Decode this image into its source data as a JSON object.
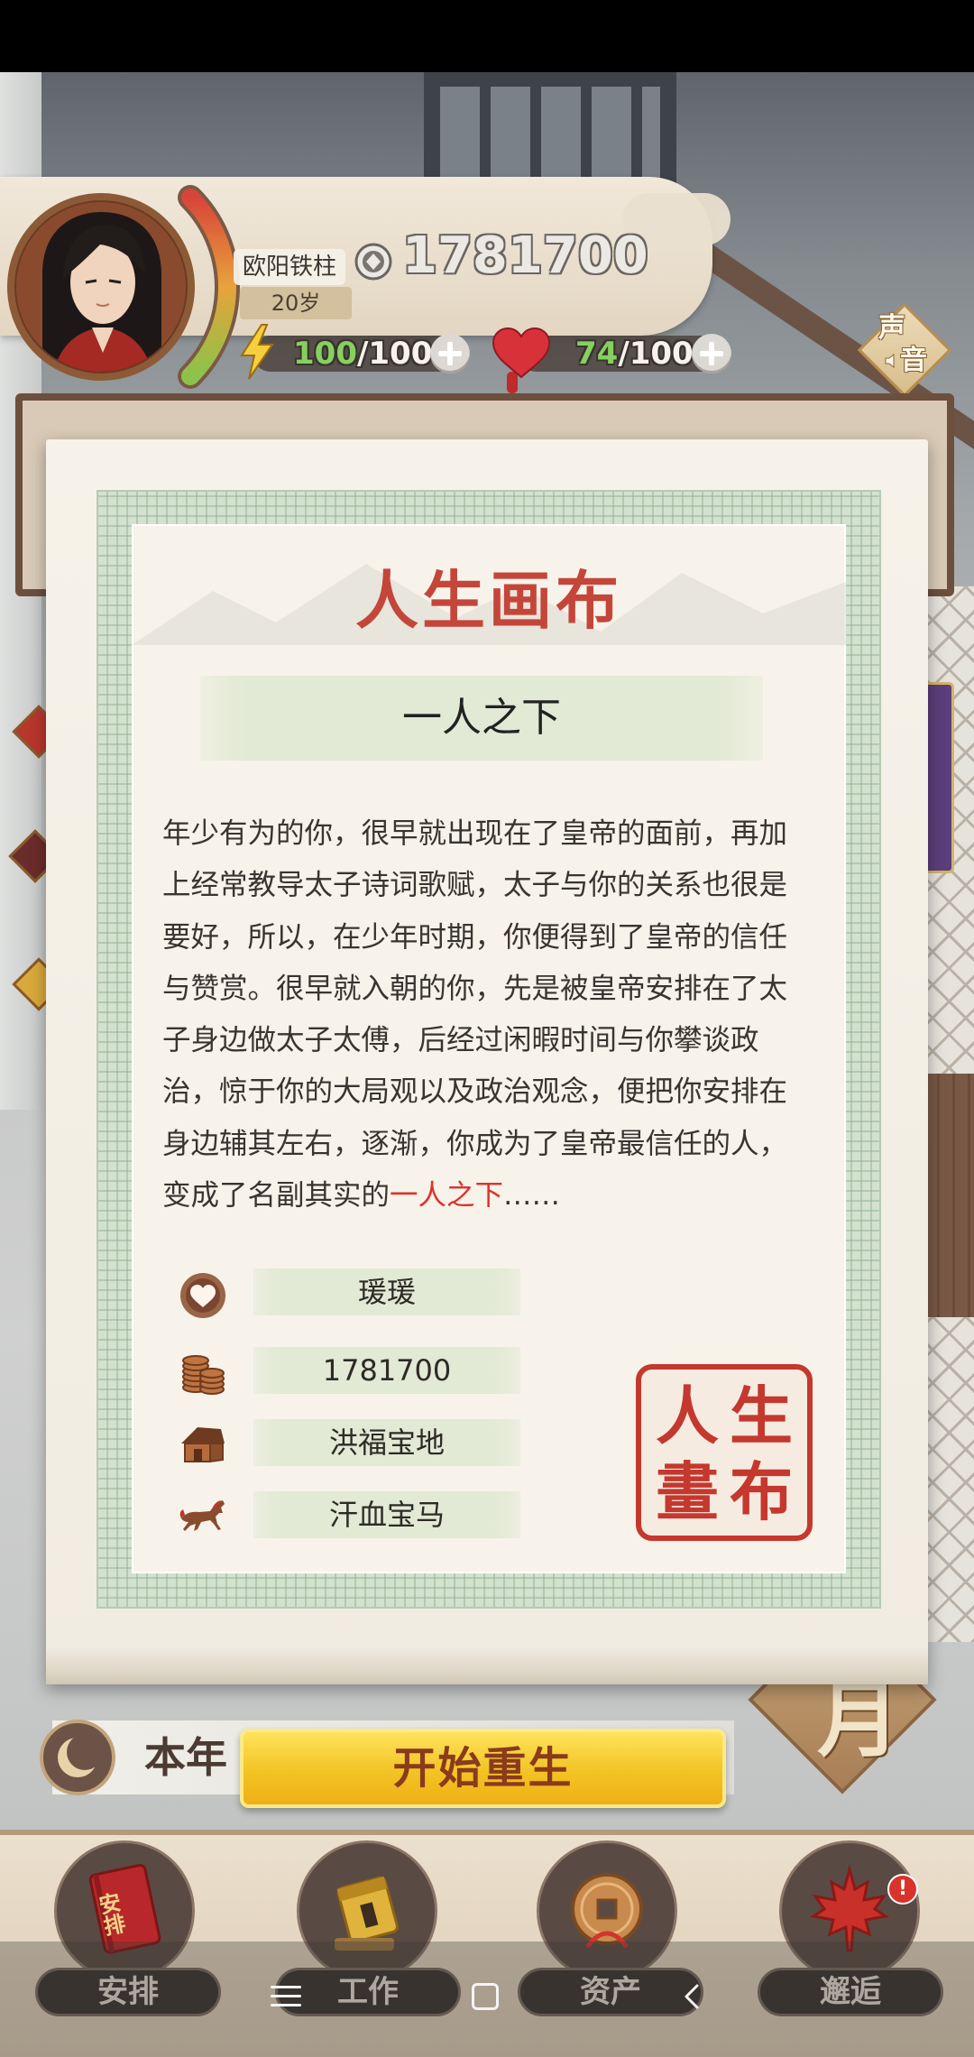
{
  "player": {
    "name": "欧阳铁柱",
    "age": "20岁",
    "coins": "1781700",
    "energy": {
      "current": "100",
      "max": "/100"
    },
    "health": {
      "current": "74",
      "max": "/100"
    }
  },
  "sound_button": {
    "char_top": "声",
    "char_bottom": "音"
  },
  "modal": {
    "title": "人生画布",
    "ending_name": "一人之下",
    "story_lines": [
      "年少有为的你，很早就出现在了皇帝的面前，再加",
      "上经常教导太子诗词歌赋，太子与你的关系也很是",
      "要好，所以，在少年时期，你便得到了皇帝的信任",
      "与赞赏。很早就入朝的你，先是被皇帝安排在了太",
      "子身边做太子太傅，后经过闲暇时间与你攀谈政",
      "治，惊于你的大局观以及政治观念，便把你安排在",
      "身边辅其左右，逐渐，你成为了皇帝最信任的人，"
    ],
    "story_last_line": {
      "prefix": "变成了名副其实的",
      "highlight": "一人之下",
      "suffix": "……"
    },
    "stats": [
      {
        "icon": "heart-icon",
        "value": "瑗瑗"
      },
      {
        "icon": "coins-icon",
        "value": "1781700"
      },
      {
        "icon": "house-icon",
        "value": "洪福宝地"
      },
      {
        "icon": "horse-icon",
        "value": "汗血宝马"
      }
    ],
    "seal": {
      "chars": [
        "人",
        "生",
        "畫",
        "布"
      ]
    }
  },
  "year_strip": {
    "label": "本年"
  },
  "month_badge": {
    "label": "月"
  },
  "rebirth_button": {
    "label": "开始重生"
  },
  "bottom_nav": {
    "items": [
      {
        "label": "安排",
        "icon": "book-icon",
        "icon_text": "安排"
      },
      {
        "label": "工作",
        "icon": "calendar-icon"
      },
      {
        "label": "资产",
        "icon": "coin-icon"
      },
      {
        "label": "邂逅",
        "icon": "maple-leaf-icon",
        "badge": "!"
      }
    ]
  },
  "system_nav": {
    "icons": [
      "menu-icon",
      "home-icon",
      "back-icon"
    ]
  },
  "colors": {
    "title_red": "#c4463a",
    "highlight_red": "#e0302a",
    "energy_green": "#86d15e",
    "button_yellow": "#f3c324",
    "button_text": "#8a3b1c",
    "paper": "#f6f2e9",
    "border_green": "#d3e1cf",
    "seal_red": "#c4382e"
  }
}
